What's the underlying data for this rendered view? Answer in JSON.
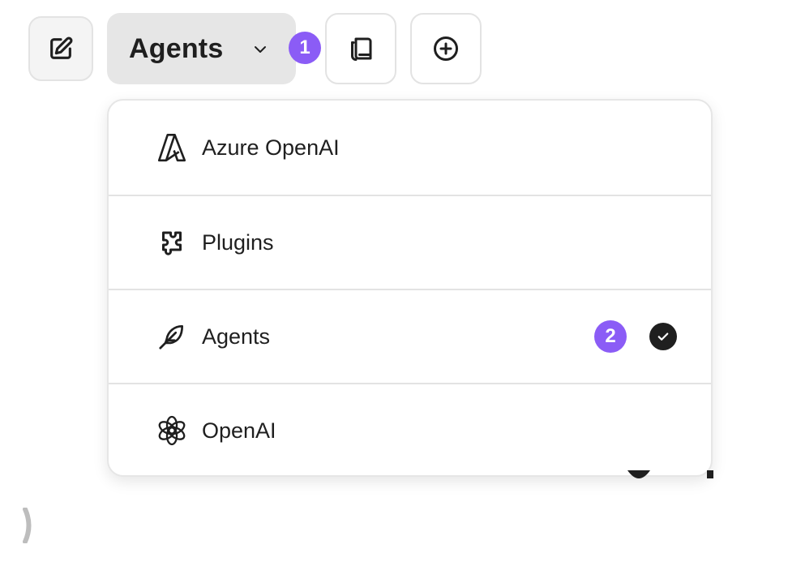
{
  "toolbar": {
    "new_chat_icon": "edit-square-icon",
    "bookmark_icon": "copy-book-icon",
    "add_icon": "plus-circle-icon"
  },
  "model_select": {
    "label": "Agents",
    "chevron_icon": "chevron-down-icon"
  },
  "badges": {
    "first": "1",
    "second": "2",
    "color": "#8b5cf6"
  },
  "menu": {
    "items": [
      {
        "label": "Azure OpenAI",
        "icon": "azure-icon",
        "selected": false
      },
      {
        "label": "Plugins",
        "icon": "plugin-icon",
        "selected": false
      },
      {
        "label": "Agents",
        "icon": "feather-icon",
        "selected": true
      },
      {
        "label": "OpenAI",
        "icon": "openai-icon",
        "selected": false
      }
    ],
    "check_icon": "check-circle-icon"
  }
}
